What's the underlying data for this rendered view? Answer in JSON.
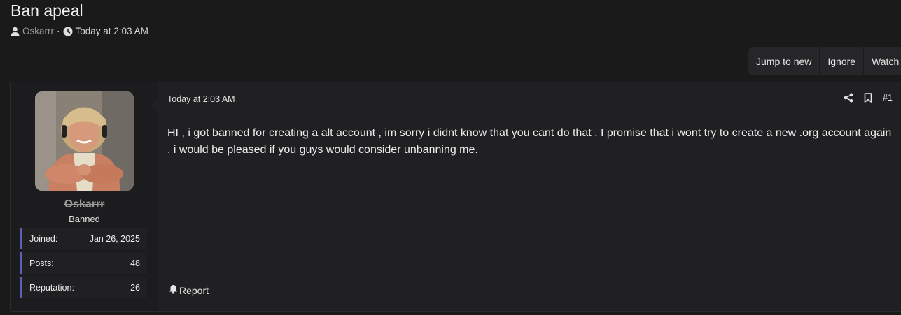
{
  "thread": {
    "title": "Ban apeal",
    "author": "Oskarrr",
    "separator": "·",
    "date": "Today at 2:03 AM"
  },
  "actions": {
    "jump_to_new": "Jump to new",
    "ignore": "Ignore",
    "watch": "Watch"
  },
  "post": {
    "date": "Today at 2:03 AM",
    "number": "#1",
    "body": "HI , i got banned for creating a alt account , im sorry i didnt know that you cant do that . I promise that i wont try to create a new .org account again , i would be pleased if you guys would consider unbanning me.",
    "report_label": "Report"
  },
  "user": {
    "name": "Oskarrr",
    "title": "Banned",
    "stats": [
      {
        "label": "Joined:",
        "value": "Jan 26, 2025"
      },
      {
        "label": "Posts:",
        "value": "48"
      },
      {
        "label": "Reputation:",
        "value": "26"
      }
    ]
  },
  "icons": {
    "user": "user-icon",
    "clock": "clock-icon",
    "share": "share-icon",
    "bookmark": "bookmark-icon",
    "bell": "bell-icon"
  },
  "colors": {
    "background": "#1a1a1b",
    "stat_accent": "#5a62b5"
  }
}
